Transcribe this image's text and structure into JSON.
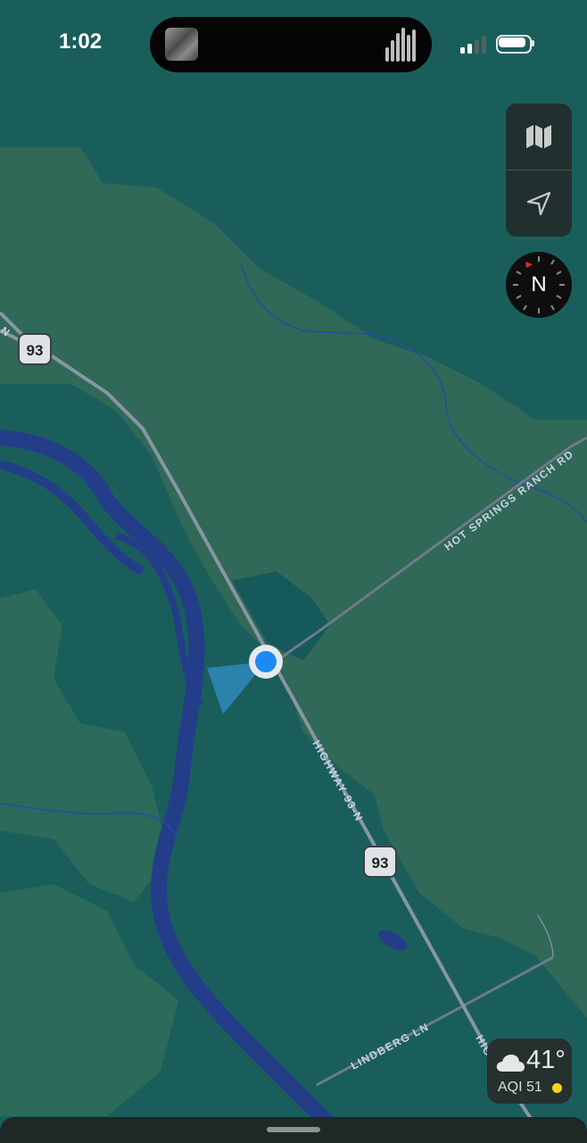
{
  "status_bar": {
    "time": "1:02"
  },
  "map": {
    "roads": {
      "highway_label": "HIGHWAY-93-N",
      "highway_label_bottom": "HIG",
      "ranch_road": "HOT SPRINGS RANCH RD",
      "lindberg": "LINDBERG LN",
      "edge_fragment": "N"
    },
    "shield_route": "93"
  },
  "controls": {
    "map_mode_icon": "map-icon",
    "locate_icon": "location-arrow-icon",
    "compass_letter": "N"
  },
  "weather": {
    "temperature": "41°",
    "aqi": "AQI 51",
    "condition_icon": "cloud-icon"
  },
  "colors": {
    "forest": "#306957",
    "lowland": "#15595a",
    "river": "#243d89",
    "highway": "#8895a5",
    "user_dot": "#1c8af0"
  }
}
